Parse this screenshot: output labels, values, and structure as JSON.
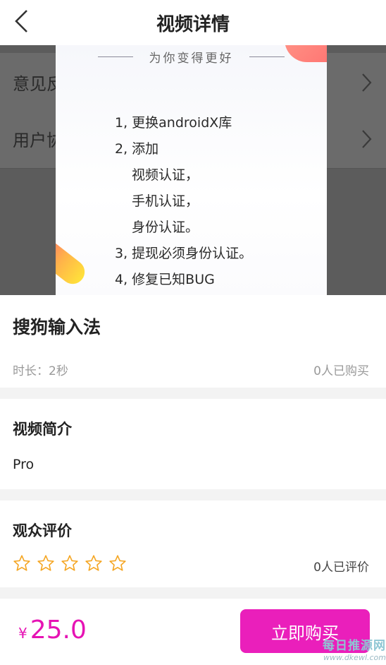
{
  "header": {
    "title": "视频详情"
  },
  "video": {
    "background_rows": [
      "意见反",
      "用户协"
    ],
    "slogan": "为你变得更好",
    "notes": [
      "1, 更换androidX库",
      " 2, 添加",
      "视频认证，",
      "手机认证，",
      "身份认证。",
      "3, 提现必须身份认证。",
      "4, 修复已知BUG"
    ]
  },
  "product": {
    "name": "搜狗输入法",
    "duration": "时长：2秒",
    "buyers": "0人已购买"
  },
  "intro": {
    "title": "视频简介",
    "text": "Pro"
  },
  "reviews": {
    "title": "观众评价",
    "stars_total": 5,
    "stars_filled": 0,
    "count": "0人已评价"
  },
  "bottom": {
    "currency": "¥",
    "price": "25.0",
    "buy_label": "立即购买"
  },
  "watermark": {
    "line1": "每日推源网",
    "line2": "www.dkewl.com"
  },
  "colors": {
    "accent": "#e613b4",
    "button": "#ea1fbb",
    "star": "#f5a623"
  }
}
